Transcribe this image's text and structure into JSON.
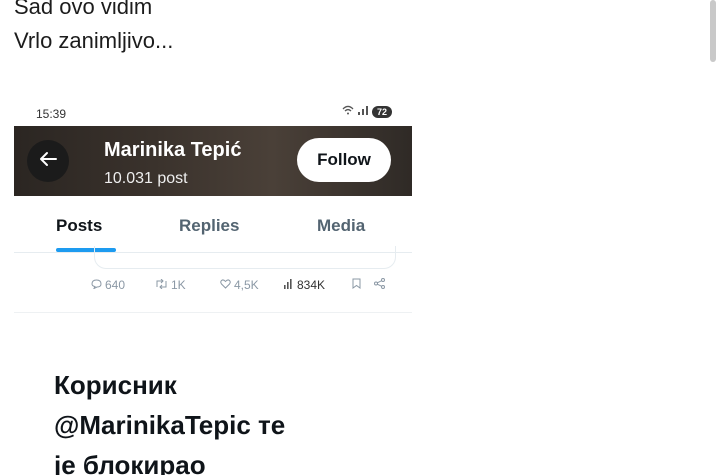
{
  "post": {
    "line1": "Sad ovo vidim",
    "line2": "Vrlo zanimljivo..."
  },
  "screenshot": {
    "status_bar": {
      "time": "15:39",
      "battery": "72"
    },
    "profile": {
      "name": "Marinika Tepić",
      "post_count": "10.031 post",
      "follow_label": "Follow"
    },
    "tabs": [
      {
        "label": "Posts"
      },
      {
        "label": "Replies"
      },
      {
        "label": "Media"
      }
    ],
    "tweet_actions": {
      "replies": "640",
      "reposts": "1K",
      "likes": "4,5K",
      "views": "834K"
    },
    "blocked_message": {
      "line1": "Корисник",
      "line2": "@MarinikaTepic те",
      "line3": "је блокирао"
    }
  },
  "colors": {
    "accent": "#1d9bf0",
    "header_bg": "#3a322c"
  },
  "icons": [
    "back-arrow-icon",
    "wifi-icon",
    "signal-icon",
    "reply-icon",
    "repost-icon",
    "like-icon",
    "views-icon",
    "bookmark-icon",
    "share-icon"
  ]
}
